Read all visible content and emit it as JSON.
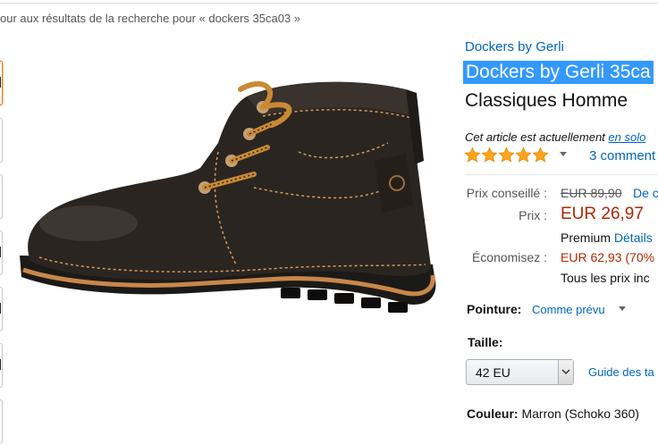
{
  "breadcrumb": "our aux résultats de la recherche pour « dockers 35ca03 »",
  "product": {
    "brand": "Dockers by Gerli",
    "title_line1": "Dockers by Gerli 35ca",
    "title_line2": "Classiques Homme",
    "availability_text": "Cet article est actuellement",
    "availability_link": "en solo",
    "rating_stars": 5,
    "reviews_text": "3 comment"
  },
  "pricing": {
    "list_label": "Prix conseillé :",
    "list_price": "EUR 89,90",
    "list_link": "De c",
    "price_label": "Prix :",
    "price": "EUR 26,97",
    "premium_text": "Premium",
    "premium_link": "Détails",
    "save_label": "Économisez :",
    "save_value": "EUR 62,93 (70%",
    "taxes": "Tous les prix inc"
  },
  "options": {
    "size_label": "Pointure:",
    "size_value": "Comme prévu",
    "taille_label": "Taille:",
    "taille_selected": "42 EU",
    "guide_link": "Guide des ta",
    "color_label": "Couleur:",
    "color_value": "Marron (Schoko 360)"
  },
  "colors": {
    "link": "#0066c0",
    "price": "#b12704",
    "star": "#ffa41c",
    "highlight": "#3399ff"
  },
  "icons": {
    "star": "star-icon",
    "dropdown": "chevron-down-icon"
  }
}
